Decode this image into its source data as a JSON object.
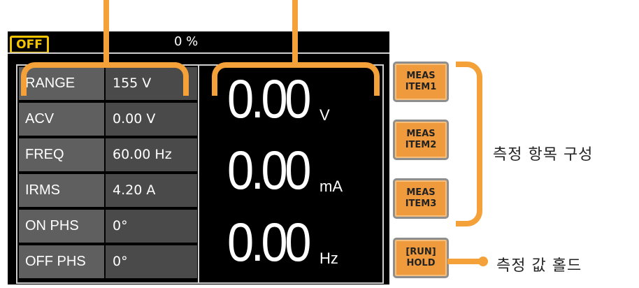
{
  "status": {
    "output_state": "OFF",
    "percent": "0 %"
  },
  "params": [
    {
      "label": "RANGE",
      "value": "155 V"
    },
    {
      "label": "ACV",
      "value": "0.00 V"
    },
    {
      "label": "FREQ",
      "value": "60.00 Hz"
    },
    {
      "label": "IRMS",
      "value": "4.20 A"
    },
    {
      "label": "ON PHS",
      "value": "0°"
    },
    {
      "label": "OFF PHS",
      "value": "0°"
    }
  ],
  "measurements": [
    {
      "value": "0.00",
      "unit": "V"
    },
    {
      "value": "0.00",
      "unit": "mA"
    },
    {
      "value": "0.00",
      "unit": "Hz"
    }
  ],
  "softkeys": [
    {
      "line1": "MEAS",
      "line2": "ITEM1"
    },
    {
      "line1": "MEAS",
      "line2": "ITEM2"
    },
    {
      "line1": "MEAS",
      "line2": "ITEM3"
    },
    {
      "line1": "[RUN]",
      "line2": "HOLD"
    }
  ],
  "annotations": {
    "meas_items_label": "측정 항목 구성",
    "hold_label": "측정 값 홀드"
  },
  "colors": {
    "accent": "#f5a13a",
    "softkey": "#ee9a3d",
    "status_off": "#f5c400"
  }
}
